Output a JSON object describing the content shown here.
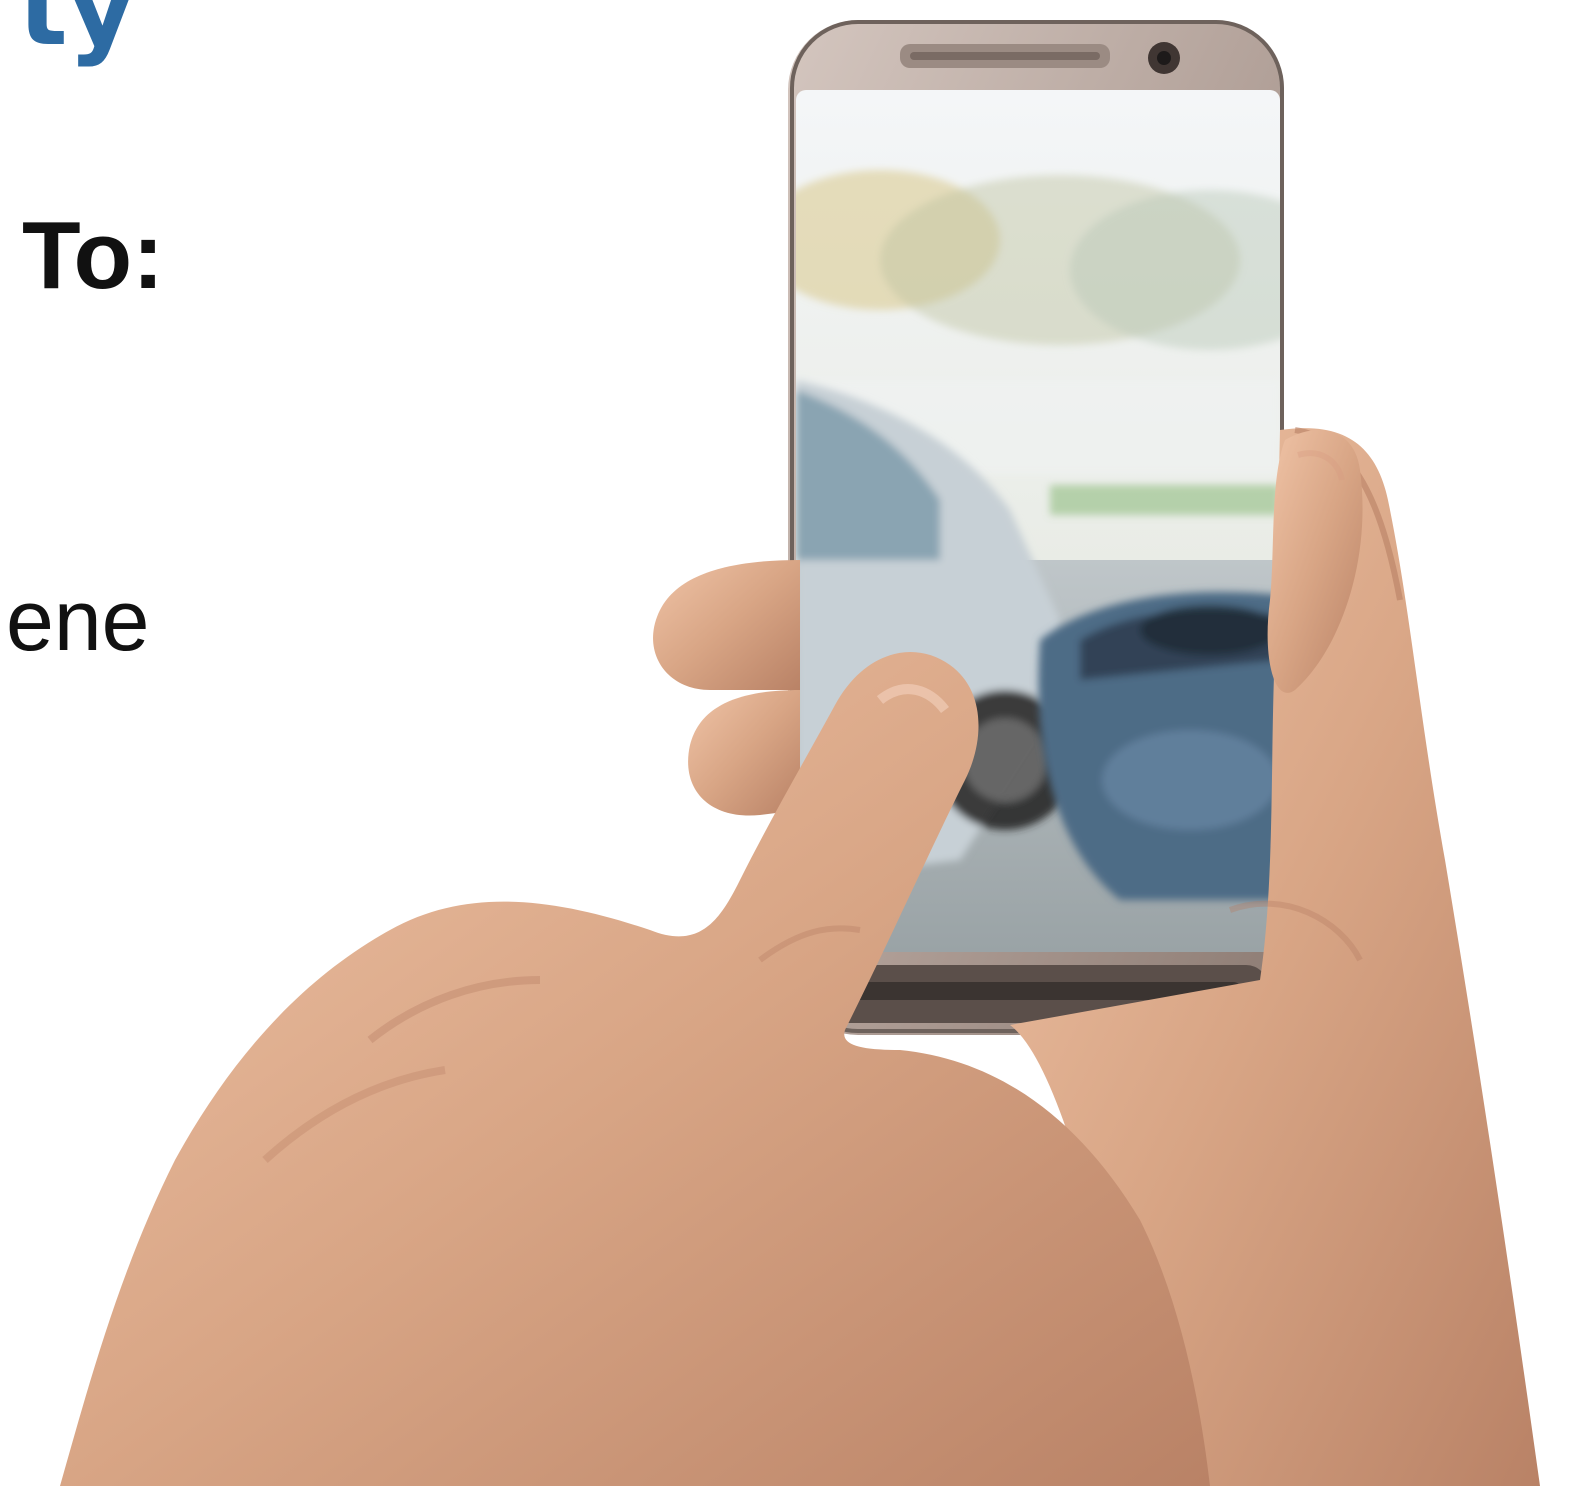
{
  "text": {
    "title_fragment": "ty",
    "heading_to": "To:",
    "body_fragment": "ene"
  },
  "colors": {
    "accent_blue": "#2d6ba3",
    "text_dark": "#111111",
    "skin": "#d8a585",
    "phone_frame": "#b3a29a"
  }
}
